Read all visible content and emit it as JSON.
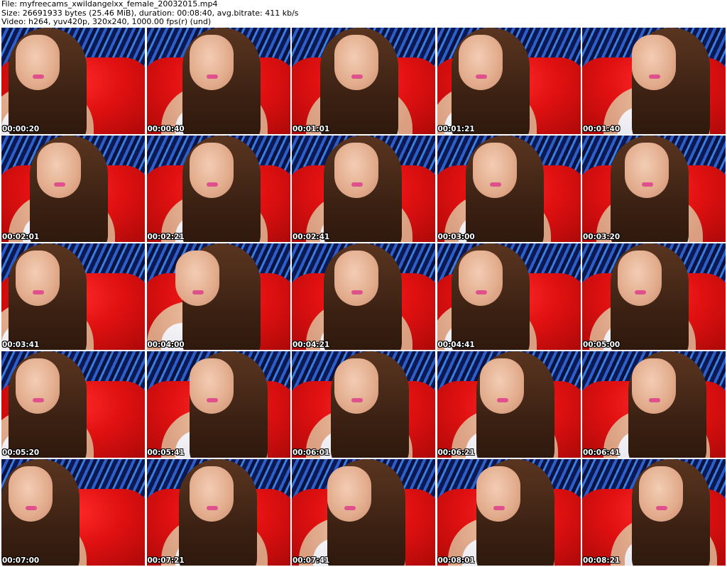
{
  "header": {
    "file_line": "File: myfreecams_xwildangelxx_female_20032015.mp4",
    "size_line": "Size: 26691933 bytes (25.46 MiB), duration: 00:08:40, avg.bitrate: 411 kb/s",
    "video_line": "Video: h264, yuv420p, 320x240, 1000.00 fps(r) (und)"
  },
  "thumbnails": [
    {
      "timestamp": "00:00:20"
    },
    {
      "timestamp": "00:00:40"
    },
    {
      "timestamp": "00:01:01"
    },
    {
      "timestamp": "00:01:21"
    },
    {
      "timestamp": "00:01:40"
    },
    {
      "timestamp": "00:02:01"
    },
    {
      "timestamp": "00:02:21"
    },
    {
      "timestamp": "00:02:41"
    },
    {
      "timestamp": "00:03:00"
    },
    {
      "timestamp": "00:03:20"
    },
    {
      "timestamp": "00:03:41"
    },
    {
      "timestamp": "00:04:00"
    },
    {
      "timestamp": "00:04:21"
    },
    {
      "timestamp": "00:04:41"
    },
    {
      "timestamp": "00:05:00"
    },
    {
      "timestamp": "00:05:20"
    },
    {
      "timestamp": "00:05:41"
    },
    {
      "timestamp": "00:06:01"
    },
    {
      "timestamp": "00:06:21"
    },
    {
      "timestamp": "00:06:41"
    },
    {
      "timestamp": "00:07:00"
    },
    {
      "timestamp": "00:07:21"
    },
    {
      "timestamp": "00:07:41"
    },
    {
      "timestamp": "00:08:01"
    },
    {
      "timestamp": "00:08:21"
    }
  ],
  "colors": {
    "background": "#ffffff",
    "text": "#000000",
    "timestamp_text": "#ffffff",
    "wall_blue": "#2e5fc8",
    "sofa_red": "#e01010",
    "top_white": "#f4f4f8"
  }
}
